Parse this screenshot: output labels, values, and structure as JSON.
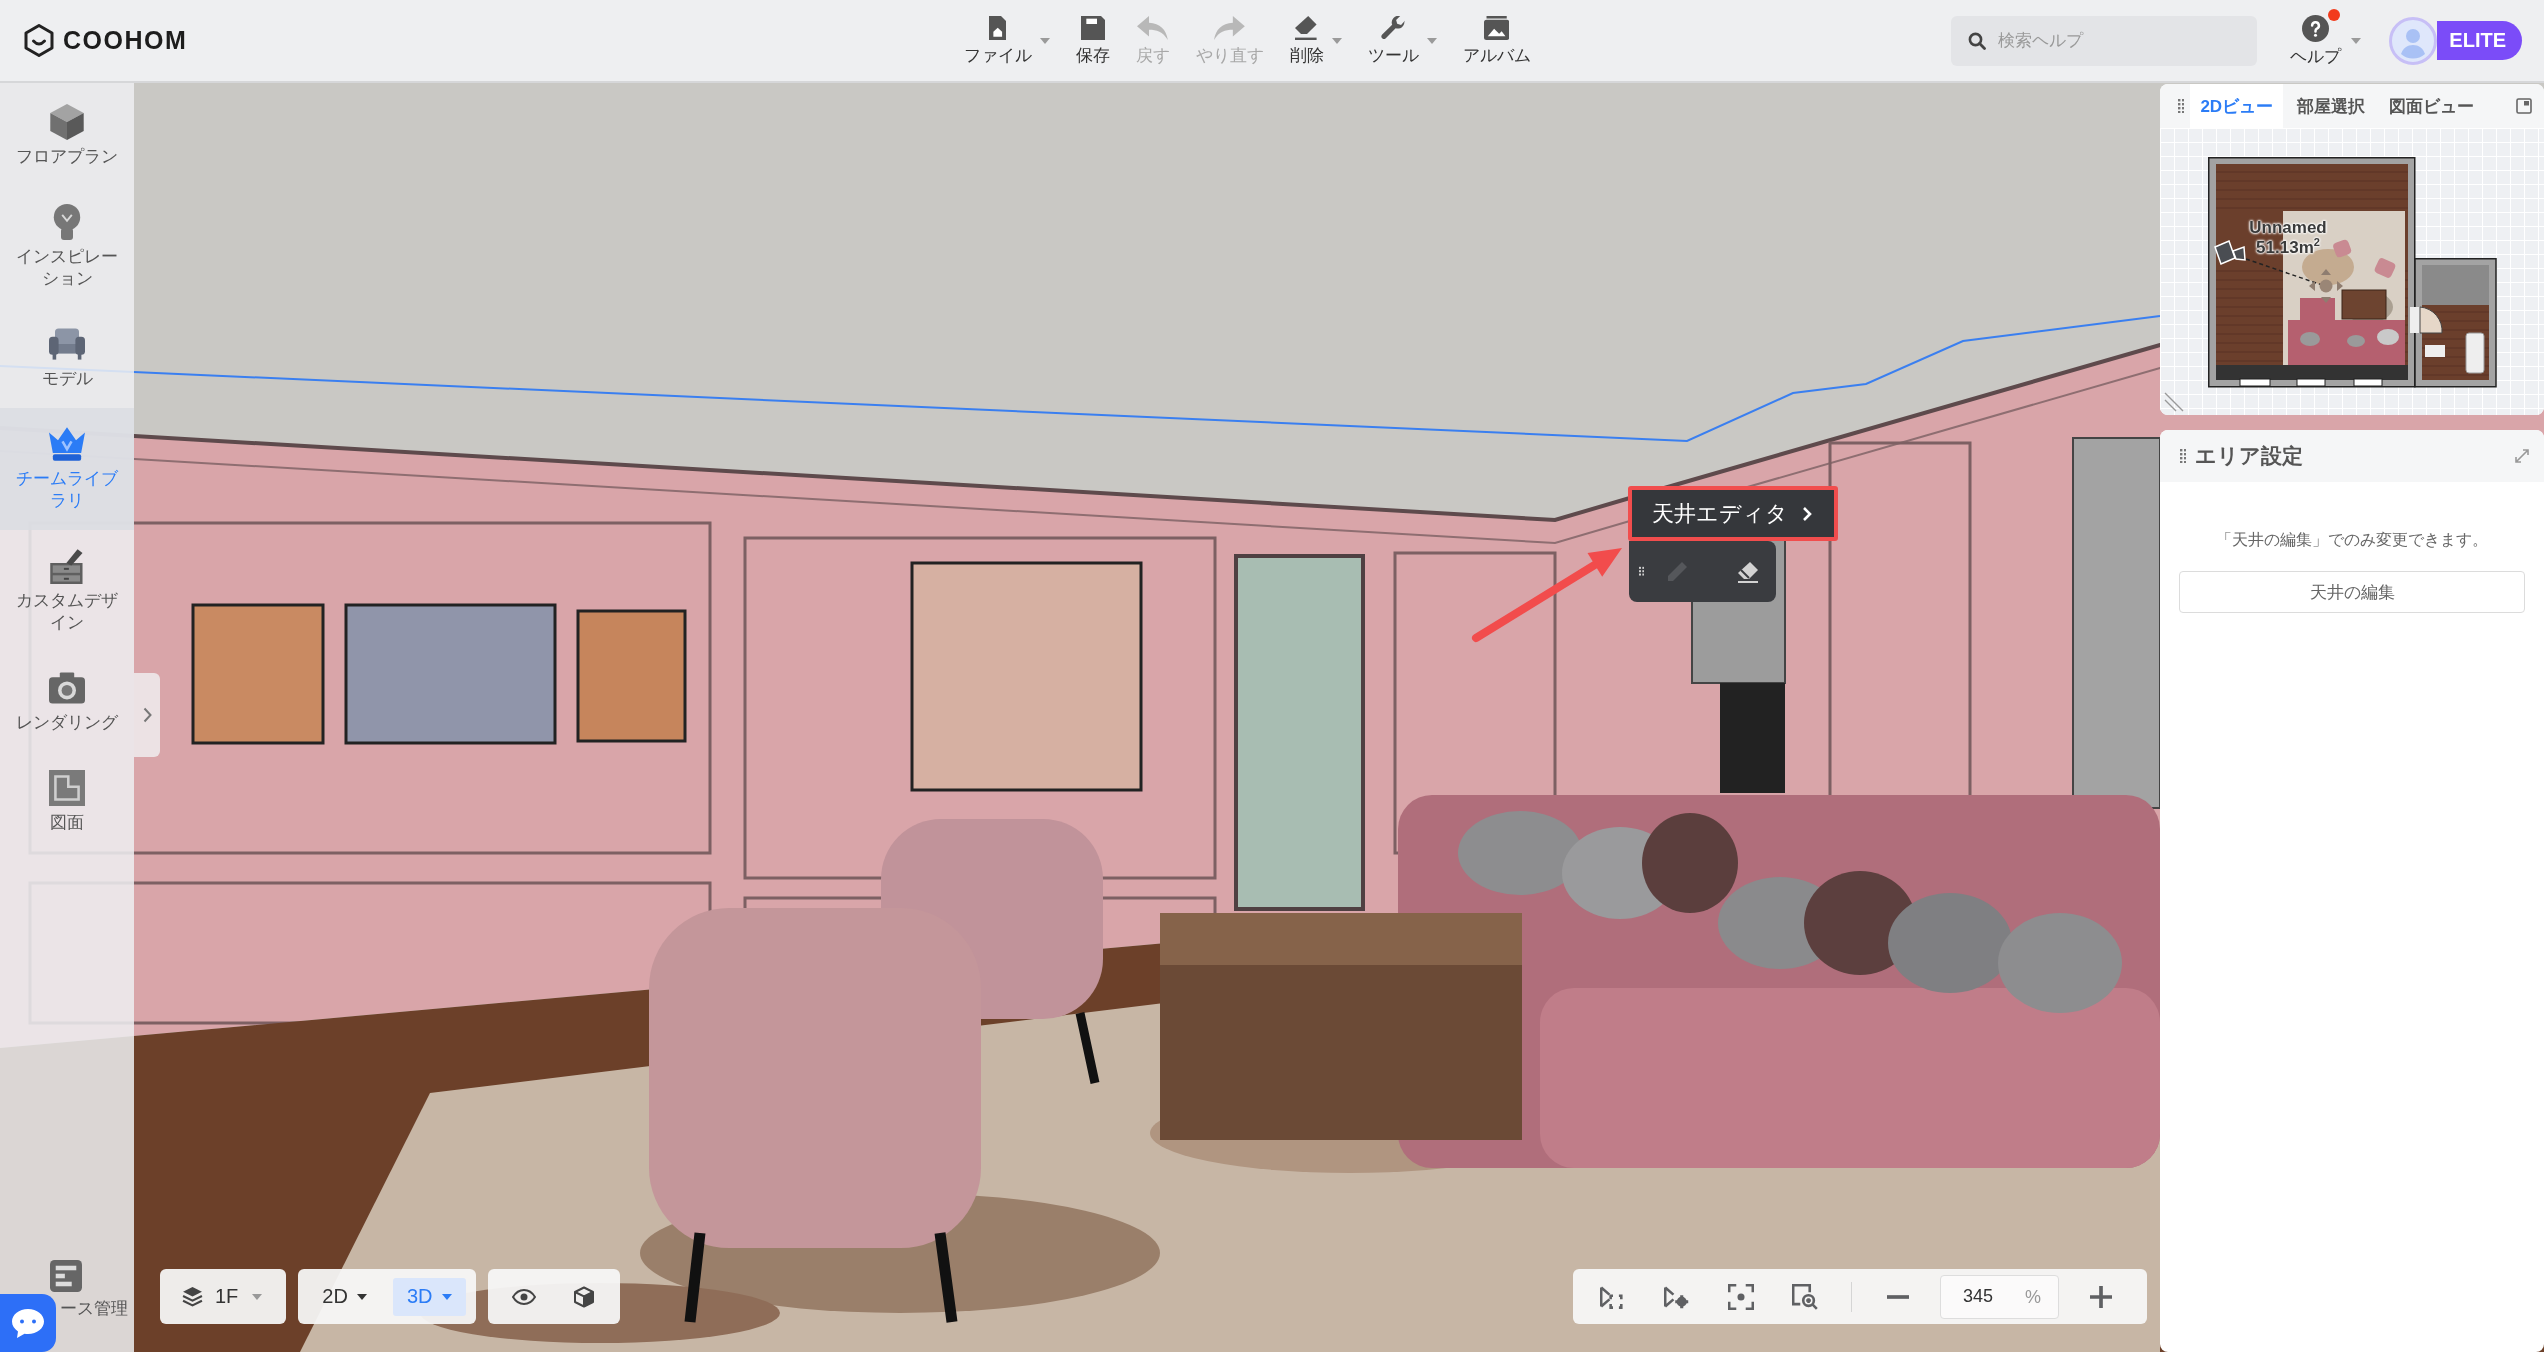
{
  "header": {
    "logo": "COOHOM",
    "toolbar": [
      {
        "kind": "file",
        "label": "ファイル",
        "disabled": false,
        "has_menu": true
      },
      {
        "kind": "save",
        "label": "保存",
        "disabled": false,
        "has_menu": false
      },
      {
        "kind": "undo",
        "label": "戻す",
        "disabled": true,
        "has_menu": false
      },
      {
        "kind": "redo",
        "label": "やり直す",
        "disabled": true,
        "has_menu": false
      },
      {
        "kind": "delete",
        "label": "削除",
        "disabled": false,
        "has_menu": true
      },
      {
        "kind": "tools",
        "label": "ツール",
        "disabled": false,
        "has_menu": true
      },
      {
        "kind": "album",
        "label": "アルバム",
        "disabled": false,
        "has_menu": false
      }
    ],
    "search": {
      "placeholder": "検索ヘルプ"
    },
    "help": {
      "label": "ヘルプ",
      "notification": true,
      "has_menu": true
    },
    "account": {
      "badge": "ELITE"
    }
  },
  "sidebar": {
    "items": [
      {
        "kind": "floorplan",
        "label": "フロアプラン",
        "selected": false
      },
      {
        "kind": "inspiration",
        "label": "インスピレーション",
        "selected": false
      },
      {
        "kind": "model",
        "label": "モデル",
        "selected": false
      },
      {
        "kind": "library",
        "label": "チームライブラリ",
        "selected": true
      },
      {
        "kind": "custom",
        "label": "カスタムデザイン",
        "selected": false
      },
      {
        "kind": "rendering",
        "label": "レンダリング",
        "selected": false
      },
      {
        "kind": "drawing",
        "label": "図面",
        "selected": false
      }
    ],
    "footer_item": {
      "label": "ース管理"
    }
  },
  "viewport": {
    "ceiling_editor": {
      "title": "天井エディタ",
      "tools": [
        {
          "kind": "pencil",
          "disabled": true
        },
        {
          "kind": "eraser",
          "disabled": false
        }
      ]
    },
    "floor_selector": {
      "label": "1F"
    },
    "view_modes": [
      {
        "label": "2D",
        "selected": false
      },
      {
        "label": "3D",
        "selected": true
      }
    ],
    "zoom": {
      "value": "345",
      "unit": "%"
    }
  },
  "panel": {
    "view_tabs": [
      {
        "label": "2Dビュー",
        "selected": true
      },
      {
        "label": "部屋選択",
        "selected": false
      },
      {
        "label": "図面ビュー",
        "selected": false
      }
    ],
    "room": {
      "name": "Unnamed",
      "area": "51.13m$^{2}$"
    },
    "area_settings": {
      "title": "エリア設定",
      "message": "「天井の編集」でのみ変更できます。",
      "button": "天井の編集"
    }
  }
}
